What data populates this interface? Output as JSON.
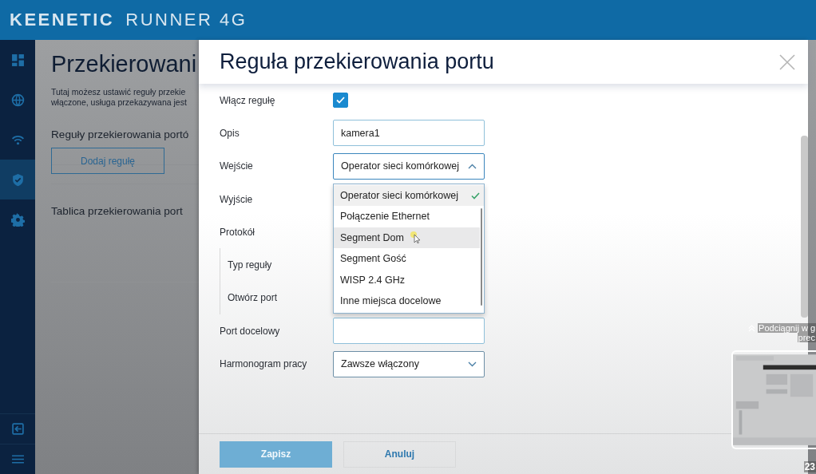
{
  "header": {
    "brand": "KEENETIC",
    "model": "RUNNER 4G"
  },
  "sidebar": {
    "items": [
      {
        "selected": false
      },
      {
        "selected": false
      },
      {
        "selected": false
      },
      {
        "selected": true
      },
      {
        "selected": false
      }
    ],
    "bottom_items": [
      {
        "selected": false
      },
      {
        "selected": false
      }
    ]
  },
  "page": {
    "title": "Przekierowani",
    "description": [
      "Tutaj możesz ustawić reguły przekie",
      "włączone, usługa przekazywana jest"
    ],
    "rules_heading": "Reguły przekierowania portó",
    "add_button": "Dodaj regułę",
    "table_heading": "Tablica przekierowania port"
  },
  "modal": {
    "title": "Reguła przekierowania portu",
    "fields": [
      {
        "kind": "checkbox",
        "label": "Włącz regułę",
        "checked": true
      },
      {
        "kind": "text",
        "label": "Opis",
        "value": "kamera1"
      },
      {
        "kind": "select",
        "label": "Wejście",
        "value": "Operator sieci komórkowej",
        "expanded": true,
        "options": [
          {
            "label": "Operator sieci komórkowej",
            "selected": true,
            "highlighted": false
          },
          {
            "label": "Połączenie Ethernet",
            "selected": false,
            "highlighted": false
          },
          {
            "label": "Segment Dom",
            "selected": false,
            "highlighted": true
          },
          {
            "label": "Segment Gość",
            "selected": false,
            "highlighted": false
          },
          {
            "label": "WISP 2.4 GHz",
            "selected": false,
            "highlighted": false
          },
          {
            "label": "Inne miejsca docelowe",
            "selected": false,
            "highlighted": false
          }
        ]
      },
      {
        "kind": "label",
        "label": "Wyjście"
      },
      {
        "kind": "label",
        "label": "Protokół"
      },
      {
        "kind": "group",
        "children": [
          {
            "kind": "label",
            "label": "Typ reguły"
          },
          {
            "kind": "label",
            "label": "Otwórz port"
          }
        ]
      },
      {
        "kind": "text",
        "label": "Port docelowy"
      },
      {
        "kind": "select",
        "label": "Harmonogram pracy",
        "value": "Zawsze włączony",
        "expanded": false
      }
    ],
    "buttons": [
      {
        "label": "Zapisz",
        "disabled": true
      },
      {
        "label": "Anuluj",
        "disabled": false
      }
    ]
  },
  "video_overlay": {
    "hint": [
      "Podciągnij w g",
      "prec"
    ],
    "timestamp": "23"
  }
}
